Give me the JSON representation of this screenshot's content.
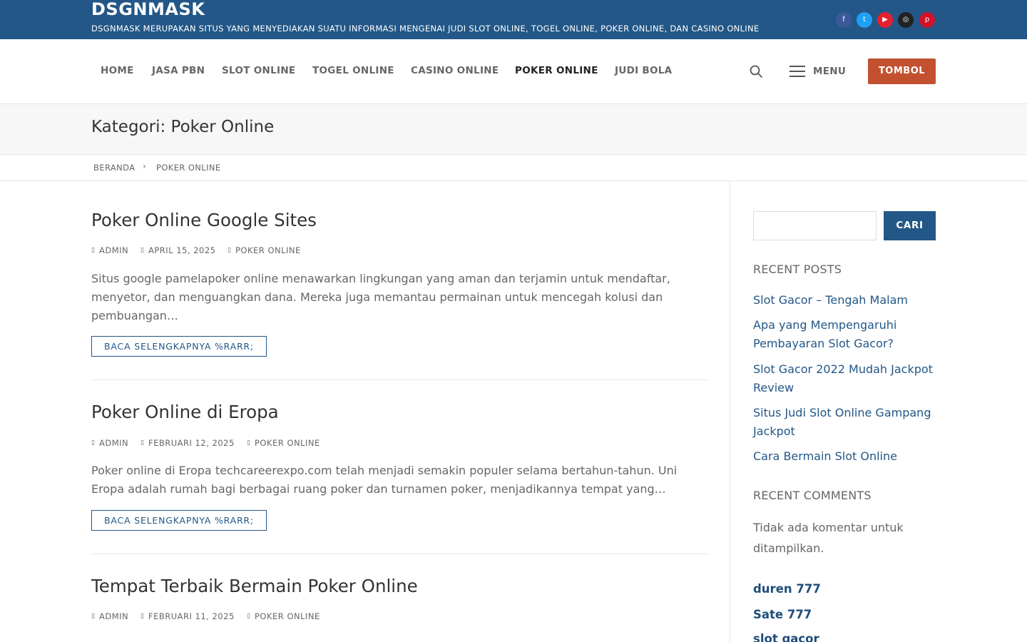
{
  "colors": {
    "topbar": "#235787",
    "accent": "#235787",
    "button_orange": "#c3512f",
    "social": [
      "#3b5998",
      "#1da1f2",
      "#e4202e",
      "#222222",
      "#d0142a"
    ]
  },
  "site": {
    "title": "DSGNMASK",
    "description": "DSGNMASK MERUPAKAN SITUS YANG MENYEDIAKAN SUATU INFORMASI MENGENAI JUDI SLOT ONLINE, TOGEL ONLINE, POKER ONLINE, DAN CASINO ONLINE"
  },
  "social_icons": [
    "facebook-icon",
    "twitter-icon",
    "youtube-icon",
    "instagram-icon",
    "pinterest-icon"
  ],
  "nav": {
    "items": [
      {
        "label": "HOME"
      },
      {
        "label": "JASA PBN"
      },
      {
        "label": "SLOT ONLINE"
      },
      {
        "label": "TOGEL ONLINE"
      },
      {
        "label": "CASINO ONLINE"
      },
      {
        "label": "POKER ONLINE"
      },
      {
        "label": "JUDI BOLA"
      }
    ],
    "active": "POKER ONLINE",
    "menu_label": "MENU",
    "button_label": "TOMBOL"
  },
  "page": {
    "title": "Kategori: Poker Online"
  },
  "breadcrumb": {
    "home": "BERANDA",
    "separator": "›",
    "current": "POKER ONLINE"
  },
  "posts": [
    {
      "title": "Poker Online Google Sites",
      "author": "ADMIN",
      "date": "APRIL 15, 2025",
      "category": "POKER ONLINE",
      "excerpt": "Situs google pamelapoker online menawarkan lingkungan yang aman dan terjamin untuk mendaftar, menyetor, dan menguangkan dana. Mereka juga memantau permainan untuk mencegah kolusi dan pembuangan…",
      "read_more": "BACA SELENGKAPNYA %RARR;"
    },
    {
      "title": "Poker Online di Eropa",
      "author": "ADMIN",
      "date": "FEBRUARI 12, 2025",
      "category": "POKER ONLINE",
      "excerpt": "Poker online di Eropa techcareerexpo.com telah menjadi semakin populer selama bertahun-tahun. Uni Eropa adalah rumah bagi berbagai ruang poker dan turnamen poker, menjadikannya tempat yang…",
      "read_more": "BACA SELENGKAPNYA %RARR;"
    },
    {
      "title": "Tempat Terbaik Bermain Poker Online",
      "author": "ADMIN",
      "date": "FEBRUARI 11, 2025",
      "category": "POKER ONLINE"
    }
  ],
  "sidebar": {
    "search_button": "CARI",
    "recent_posts_title": "RECENT POSTS",
    "recent_posts": [
      "Slot Gacor – Tengah Malam",
      "Apa yang Mempengaruhi Pembayaran Slot Gacor?",
      "Slot Gacor 2022 Mudah Jackpot Review",
      "Situs Judi Slot Online Gampang Jackpot",
      "Cara Bermain Slot Online"
    ],
    "recent_comments_title": "RECENT COMMENTS",
    "no_comments": "Tidak ada komentar untuk ditampilkan.",
    "links": [
      "duren 777",
      "Sate 777",
      "slot gacor"
    ]
  }
}
